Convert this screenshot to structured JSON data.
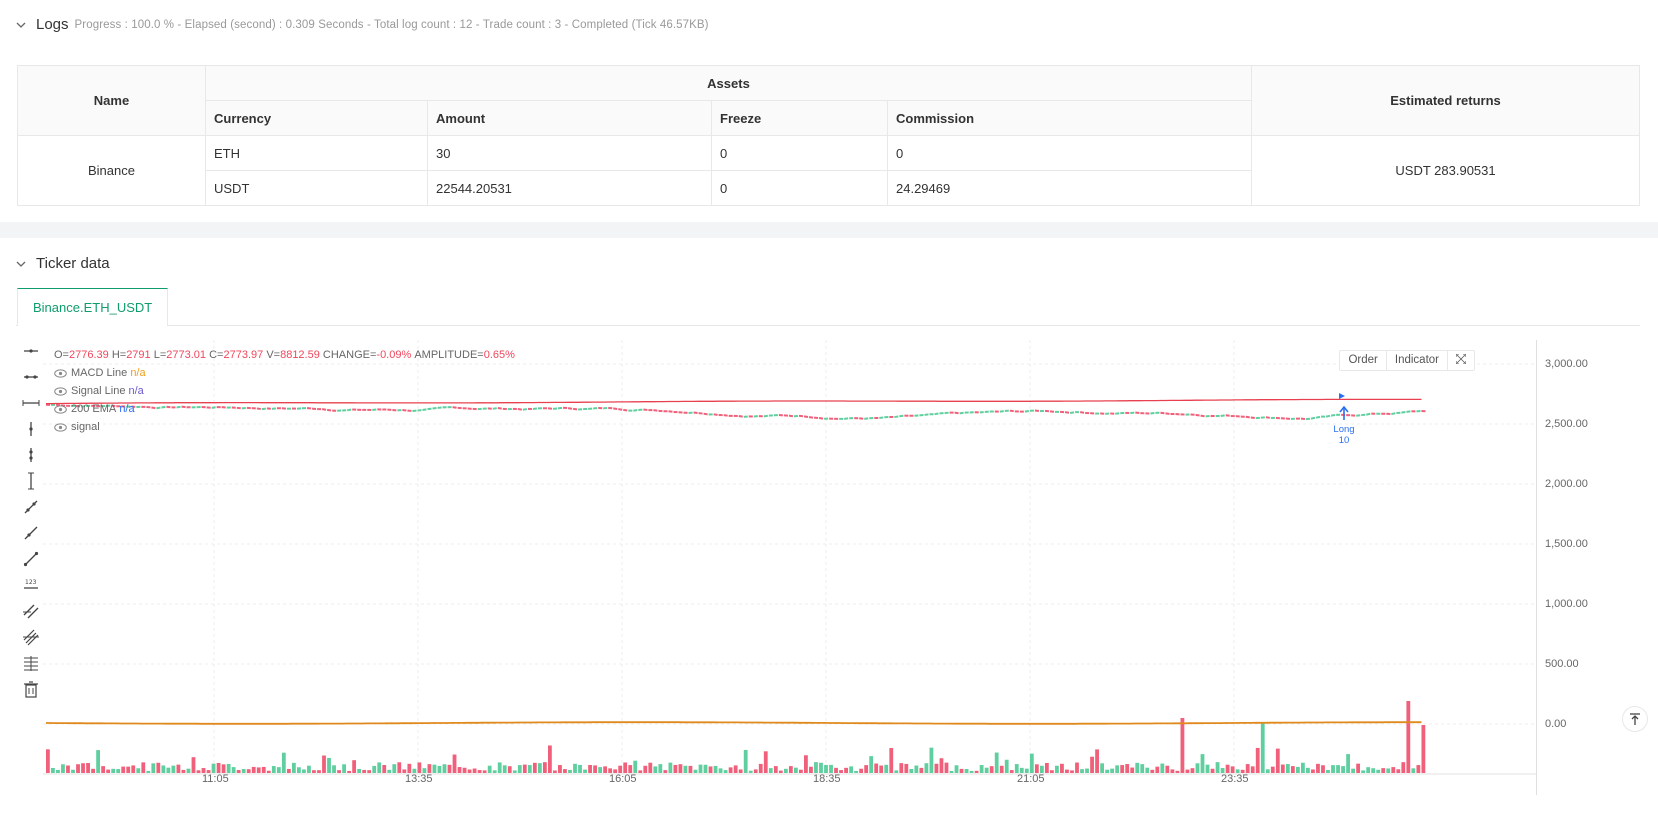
{
  "logs": {
    "title": "Logs",
    "meta": "Progress : 100.0 % - Elapsed (second) : 0.309  Seconds - Total log count : 12 - Trade count : 3 - Completed (Tick 46.57KB)"
  },
  "assets_table": {
    "name_header": "Name",
    "assets_header": "Assets",
    "returns_header": "Estimated returns",
    "columns": [
      "Currency",
      "Amount",
      "Freeze",
      "Commission"
    ],
    "exchange": "Binance",
    "rows": [
      {
        "currency": "ETH",
        "amount": "30",
        "freeze": "0",
        "commission": "0"
      },
      {
        "currency": "USDT",
        "amount": "22544.20531",
        "freeze": "0",
        "commission": "24.29469"
      }
    ],
    "estimated_returns": "USDT 283.90531"
  },
  "ticker": {
    "title": "Ticker data",
    "tab": "Binance.ETH_USDT"
  },
  "chart_header": {
    "o_label": "O=",
    "o_value": "2776.39",
    "h_label": "H=",
    "h_value": "2791",
    "l_label": "L=",
    "l_value": "2773.01",
    "c_label": "C=",
    "c_value": "2773.97",
    "v_label": "V=",
    "v_value": "8812.59",
    "change_label": "CHANGE=",
    "change_value": "-0.09%",
    "amp_label": "AMPLITUDE=",
    "amp_value": "0.65%",
    "indicators": [
      {
        "name": "MACD Line",
        "value": "n/a",
        "color": "#f0a020"
      },
      {
        "name": "Signal Line",
        "value": "n/a",
        "color": "#6a5acd"
      },
      {
        "name": "200 EMA",
        "value": "n/a",
        "color": "#2a6ff0"
      },
      {
        "name": "signal",
        "value": "",
        "color": "#999999"
      }
    ],
    "order_button": "Order",
    "indicator_button": "Indicator"
  },
  "chart_data": {
    "type": "line",
    "y_ticks": [
      "3,000.00",
      "2,500.00",
      "2,000.00",
      "1,500.00",
      "1,000.00",
      "500.00",
      "0.00"
    ],
    "x_ticks": [
      "11:05",
      "13:35",
      "16:05",
      "18:35",
      "21:05",
      "23:35"
    ],
    "ylim": [
      -250,
      3300
    ],
    "price_approx": 2700,
    "ema_approx": 2690,
    "marker": {
      "label": "Long",
      "qty": "10",
      "color": "#2a6ff0"
    },
    "up_color": "#5fcf9f",
    "down_color": "#f0607a",
    "macd_color": "#e08a1e"
  }
}
